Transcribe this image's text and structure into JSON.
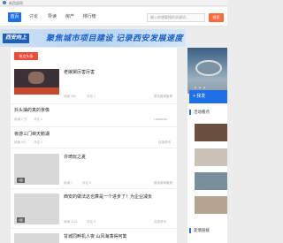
{
  "topbar": {
    "site_name": "新西部网"
  },
  "nav": {
    "items": [
      {
        "label": "首页",
        "active": true
      },
      {
        "label": "讨论",
        "active": false
      },
      {
        "label": "导读",
        "active": false
      },
      {
        "label": "房产",
        "active": false
      },
      {
        "label": "排行榜",
        "active": false
      }
    ],
    "search_placeholder": "输入你想要搜的关键词...",
    "search_button": "搜索"
  },
  "banner": {
    "logo_text": "西安向上",
    "slogan": "聚焦城市项目建设 记录西安发展速度"
  },
  "main": {
    "tab_label": "热点头条",
    "articles": [
      {
        "title": "老娘舅厉害厉害",
        "comments": "阅读 260",
        "likes": "评论 1",
        "source": "原创新闻聚焦"
      },
      {
        "title": "抖头抽的真的亲像",
        "comments": "阅读 2 万",
        "likes": "评论 1",
        "source": "Laksanaa"
      },
      {
        "title": "夜游三门峡天鹅湖",
        "comments": "阅读 412",
        "likes": "评论 1",
        "source": "百事资讯"
      },
      {
        "title": "许琦玩之夏",
        "comments": "阅读 7",
        "likes": "评论 0",
        "source": "原创新闻聚焦",
        "tag": "1图"
      },
      {
        "title": "西安的做法这也算是一个进步了！为企业减负",
        "comments": "阅读 1121",
        "likes": "评论 0",
        "source": "百事资讯",
        "tag": "1图"
      },
      {
        "title": "甘城同畔机人夜 山风海荡得何篱",
        "comments": "",
        "likes": "",
        "source": ""
      }
    ]
  },
  "sidebar": {
    "more_label": "+ 我发",
    "section1": "活动看点",
    "section2": "友情链接"
  },
  "colors": {
    "accent": "#1e6fe8",
    "hot": "#ef4a3a",
    "search_btn": "#ff6a3d"
  }
}
